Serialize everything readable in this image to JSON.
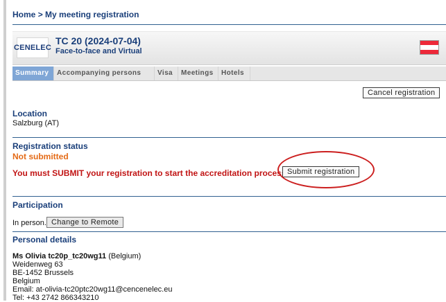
{
  "breadcrumb": {
    "home": "Home",
    "separator": ">",
    "current": "My meeting registration"
  },
  "meeting": {
    "code": "TC 20 (2024-07-04)",
    "type": "Face-to-face and Virtual",
    "logo_text": "CENELEC"
  },
  "tabs": [
    {
      "label": "Summary",
      "active": true
    },
    {
      "label": "Accompanying persons",
      "active": false
    },
    {
      "label": "Visa",
      "active": false
    },
    {
      "label": "Meetings",
      "active": false
    },
    {
      "label": "Hotels",
      "active": false
    }
  ],
  "buttons": {
    "cancel": "Cancel registration",
    "submit": "Submit registration",
    "change_remote": "Change to Remote"
  },
  "location": {
    "title": "Location",
    "value": "Salzburg (AT)"
  },
  "status": {
    "title": "Registration status",
    "value": "Not submitted",
    "message": "You must SUBMIT your registration to start the accreditation process!"
  },
  "participation": {
    "title": "Participation",
    "mode": "In person."
  },
  "personal": {
    "title": "Personal details",
    "name": "Ms Olivia tc20p_tc20wg11",
    "country_paren": "(Belgium)",
    "street": "Weidenweg 63",
    "city": "BE-1452 Brussels",
    "country": "Belgium",
    "email": "Email: at-olivia-tc20ptc20wg11@cencenelec.eu",
    "tel": "Tel: +43 2742 866343210"
  },
  "colors": {
    "accent": "#1a3f7a",
    "status_orange": "#e46a16",
    "alert_red": "#c11414",
    "tab_active": "#7fa6d6"
  }
}
